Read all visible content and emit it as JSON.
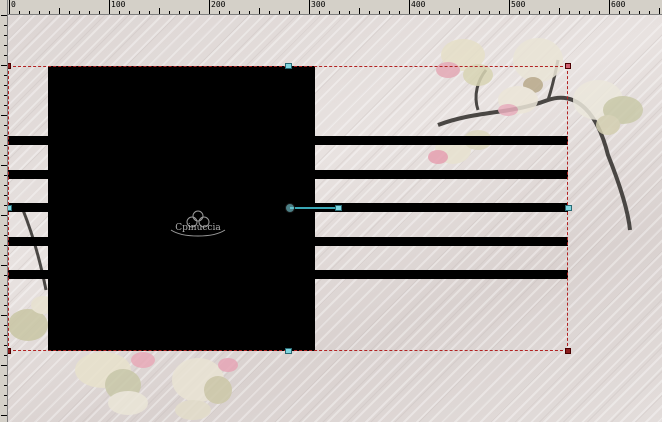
{
  "ruler": {
    "labels": [
      "0",
      "100",
      "200",
      "300",
      "400",
      "500",
      "600"
    ]
  },
  "canvas": {
    "watermark_text": "Cpinuccia"
  },
  "colors": {
    "background": "#e3dddb",
    "bars": "#000000",
    "selection": "#b22222",
    "handle": "#8b1c1c",
    "handle_cyan": "#7fd6e0"
  },
  "icons": {
    "rotation_handle": "pivot-handle-icon",
    "corner_handle": "resize-handle-icon"
  }
}
